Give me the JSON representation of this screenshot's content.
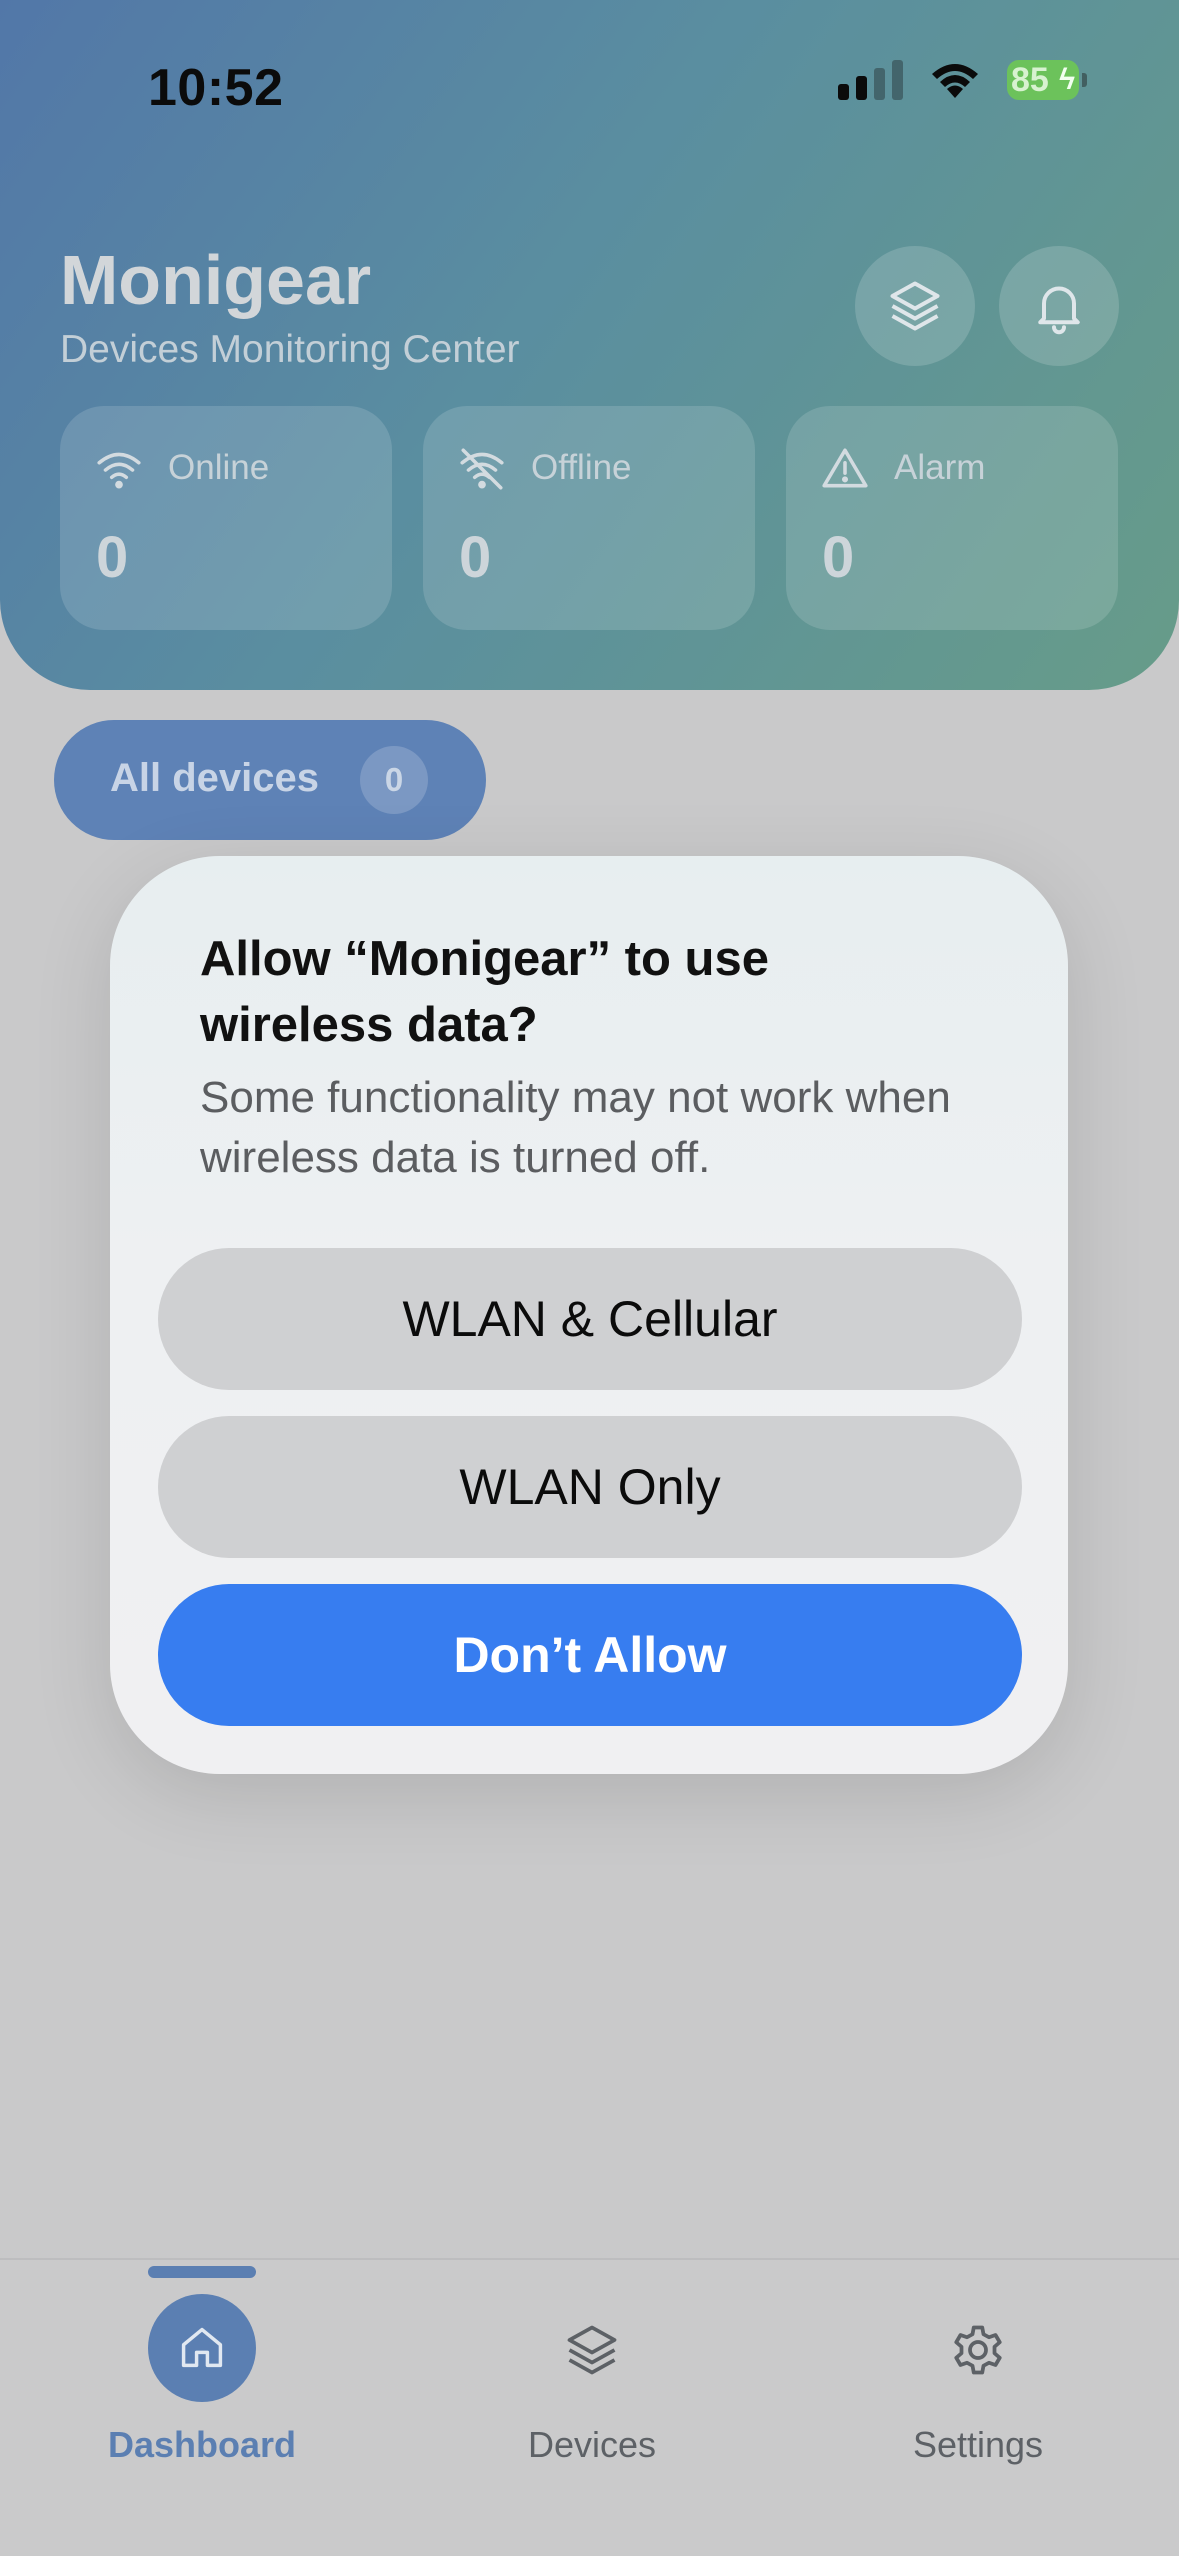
{
  "status_bar": {
    "time": "10:52",
    "battery_percent": "85"
  },
  "header": {
    "app_name": "Monigear",
    "subtitle": "Devices Monitoring Center",
    "icons": [
      "layers-icon",
      "bell-icon"
    ]
  },
  "stats": [
    {
      "label": "Online",
      "value": "0",
      "icon": "wifi-icon"
    },
    {
      "label": "Offline",
      "value": "0",
      "icon": "wifi-off-icon"
    },
    {
      "label": "Alarm",
      "value": "0",
      "icon": "warning-icon"
    }
  ],
  "filter": {
    "label": "All devices",
    "count": "0"
  },
  "dialog": {
    "title": "Allow “Monigear” to use wireless data?",
    "message": "Some functionality may not work when wireless data is turned off.",
    "buttons": {
      "wlan_cellular": "WLAN & Cellular",
      "wlan_only": "WLAN Only",
      "dont_allow": "Don’t Allow"
    }
  },
  "tabs": [
    {
      "label": "Dashboard",
      "icon": "home-icon",
      "active": true
    },
    {
      "label": "Devices",
      "icon": "layers-icon",
      "active": false
    },
    {
      "label": "Settings",
      "icon": "gear-icon",
      "active": false
    }
  ],
  "colors": {
    "accent_blue": "#377df0",
    "tab_active": "#5b7fb2",
    "battery_green": "#6cc25b"
  }
}
